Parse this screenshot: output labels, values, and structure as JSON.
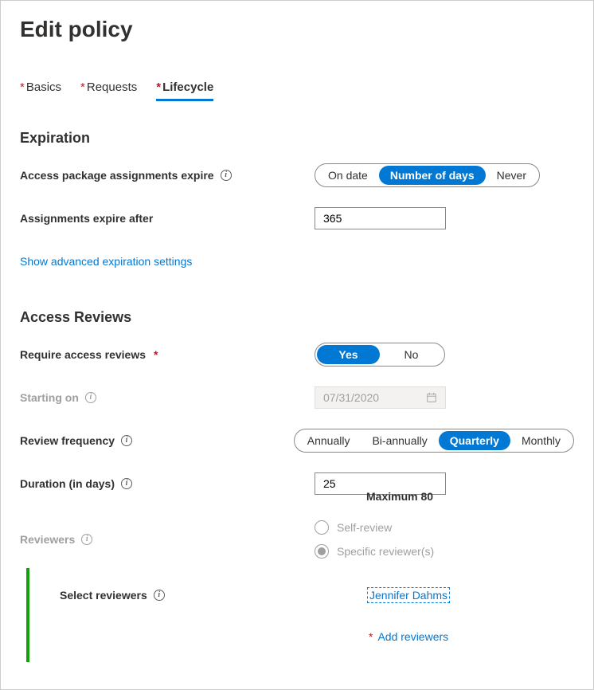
{
  "title": "Edit policy",
  "tabs": {
    "basics": "Basics",
    "requests": "Requests",
    "lifecycle": "Lifecycle"
  },
  "expiration": {
    "heading": "Expiration",
    "assignments_expire_label": "Access package assignments expire",
    "options": {
      "on_date": "On date",
      "num_days": "Number of days",
      "never": "Never"
    },
    "expire_after_label": "Assignments expire after",
    "expire_after_value": "365",
    "advanced_link": "Show advanced expiration settings"
  },
  "reviews": {
    "heading": "Access Reviews",
    "require_label": "Require access reviews",
    "yes": "Yes",
    "no": "No",
    "starting_label": "Starting on",
    "starting_value": "07/31/2020",
    "frequency_label": "Review frequency",
    "freq": {
      "annually": "Annually",
      "bi": "Bi-annually",
      "quarterly": "Quarterly",
      "monthly": "Monthly"
    },
    "duration_label": "Duration (in days)",
    "duration_value": "25",
    "duration_helper": "Maximum 80",
    "reviewers_label": "Reviewers",
    "self_review": "Self-review",
    "specific": "Specific reviewer(s)",
    "select_reviewers_label": "Select reviewers",
    "selected_reviewer": "Jennifer Dahms",
    "add_reviewers": "Add reviewers"
  }
}
